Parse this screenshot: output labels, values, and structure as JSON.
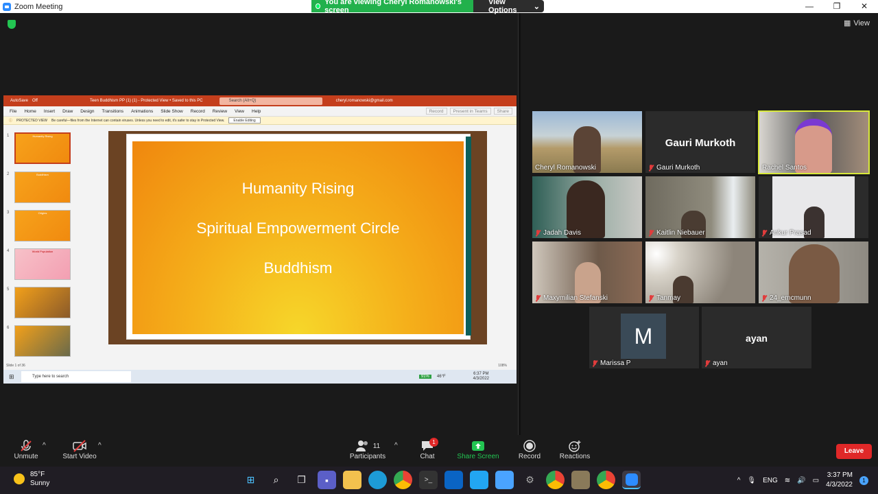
{
  "window": {
    "title": "Zoom Meeting",
    "banner": "You are viewing Cheryl Romanowski's screen",
    "view_options": "View Options",
    "view_label": "View",
    "controls": [
      "—",
      "❐",
      "✕"
    ]
  },
  "shared_screen": {
    "title_bar": {
      "autosave": "AutoSave",
      "autosave_state": "Off",
      "filename": "Teen Buddhism PP (1) (1) - Protected View • Saved to this PC",
      "search": "Search (Alt+Q)",
      "account": "cheryl.romanowski@gmail.com"
    },
    "menu": [
      "File",
      "Home",
      "Insert",
      "Draw",
      "Design",
      "Transitions",
      "Animations",
      "Slide Show",
      "Record",
      "Review",
      "View",
      "Help"
    ],
    "menu_right": [
      "Record",
      "Present in Teams",
      "Share"
    ],
    "protected_bar": {
      "label": "PROTECTED VIEW",
      "message": "Be careful—files from the Internet can contain viruses. Unless you need to edit, it's safer to stay in Protected View.",
      "button": "Enable Editing"
    },
    "thumbnails": [
      {
        "num": "1",
        "title": "Humanity Rising"
      },
      {
        "num": "2",
        "title": "Buddhism"
      },
      {
        "num": "3",
        "title": "Origins"
      },
      {
        "num": "4",
        "title": "World Population"
      },
      {
        "num": "5",
        "title": ""
      },
      {
        "num": "6",
        "title": ""
      }
    ],
    "slide": {
      "line1": "Humanity Rising",
      "line2": "Spiritual Empowerment Circle",
      "line3": "Buddhism"
    },
    "status": "Slide 1 of 36",
    "zoom": "108%",
    "taskbar": {
      "search": "Type here to search",
      "battery": "91%",
      "temp": "46°F",
      "time": "6:37 PM",
      "date": "4/3/2022"
    }
  },
  "participants_tiles": [
    {
      "name": "Cheryl Romanowski",
      "muted": false,
      "video": true
    },
    {
      "name": "Gauri Murkoth",
      "muted": true,
      "video": false,
      "display": "Gauri Murkoth"
    },
    {
      "name": "Rachel Santos",
      "muted": false,
      "video": true,
      "active": true
    },
    {
      "name": "Jadah Davis",
      "muted": true,
      "video": true
    },
    {
      "name": "Kaitlin Niebauer",
      "muted": true,
      "video": true
    },
    {
      "name": "Ankur Prasad",
      "muted": true,
      "video": true
    },
    {
      "name": "Maxymilian Stefanski",
      "muted": true,
      "video": true
    },
    {
      "name": "Tanmay",
      "muted": true,
      "video": true
    },
    {
      "name": "24_emcmunn",
      "muted": true,
      "video": true
    },
    {
      "name": "Marissa P",
      "muted": true,
      "video": false,
      "initial": "M"
    },
    {
      "name": "ayan",
      "muted": true,
      "video": false,
      "display": "ayan"
    }
  ],
  "toolbar": {
    "unmute": "Unmute",
    "start_video": "Start Video",
    "participants": "Participants",
    "participants_count": "11",
    "chat": "Chat",
    "chat_badge": "1",
    "share_screen": "Share Screen",
    "record": "Record",
    "reactions": "Reactions",
    "leave": "Leave"
  },
  "taskbar": {
    "weather_temp": "85°F",
    "weather_desc": "Sunny",
    "lang": "ENG",
    "time": "3:37 PM",
    "date": "4/3/2022",
    "notif": "1"
  }
}
